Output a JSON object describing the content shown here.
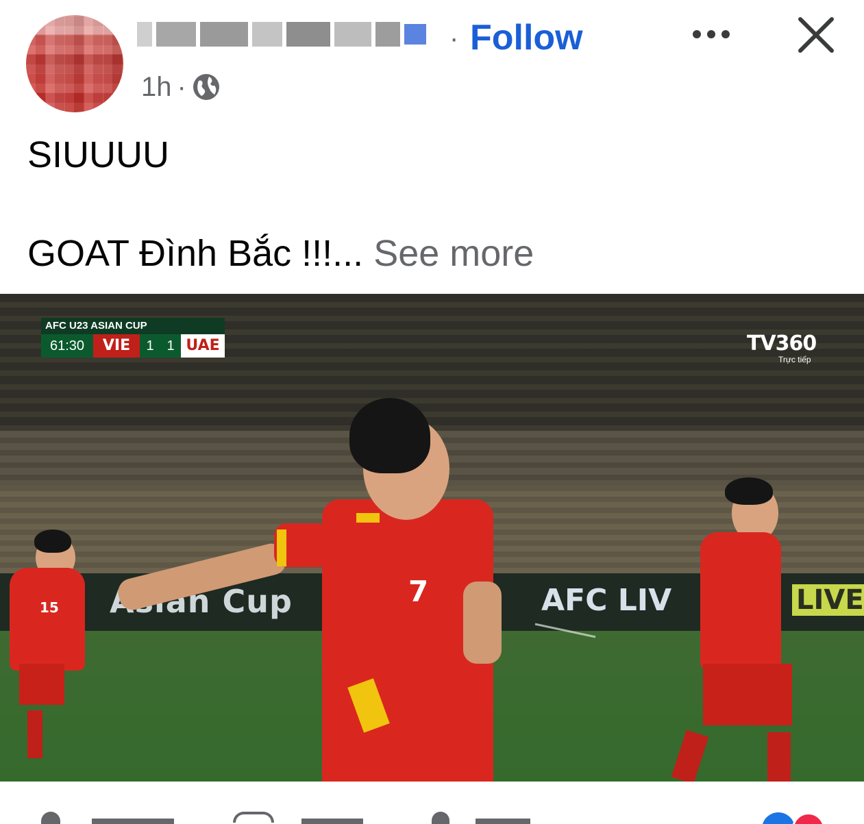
{
  "header": {
    "follow_label": "Follow",
    "follow_separator": "·",
    "time": "1h",
    "time_separator": "·",
    "audience_icon": "globe-icon",
    "more_icon": "more-horizontal-icon",
    "close_icon": "close-icon"
  },
  "post": {
    "line1": "SIUUUU",
    "line2": "GOAT Đình Bắc !!!...",
    "see_more_label": "See more"
  },
  "media": {
    "scoreboard": {
      "competition": "AFC U23 ASIAN CUP",
      "clock": "61:30",
      "home_team": "VIE",
      "home_score": "1",
      "away_score": "1",
      "away_team": "UAE"
    },
    "broadcaster": {
      "logo": "TV360",
      "live_label": "Trực tiếp"
    },
    "ad_boards": {
      "left": "Asian Cup",
      "middle": "AFC LIV",
      "right": "LIVE"
    },
    "player_numbers": {
      "center": "7",
      "left": "15"
    }
  },
  "colors": {
    "follow_blue": "#1b5fd6",
    "secondary_text": "#65676b",
    "jersey_red": "#d9271f",
    "jersey_yellow": "#f1c40f"
  }
}
